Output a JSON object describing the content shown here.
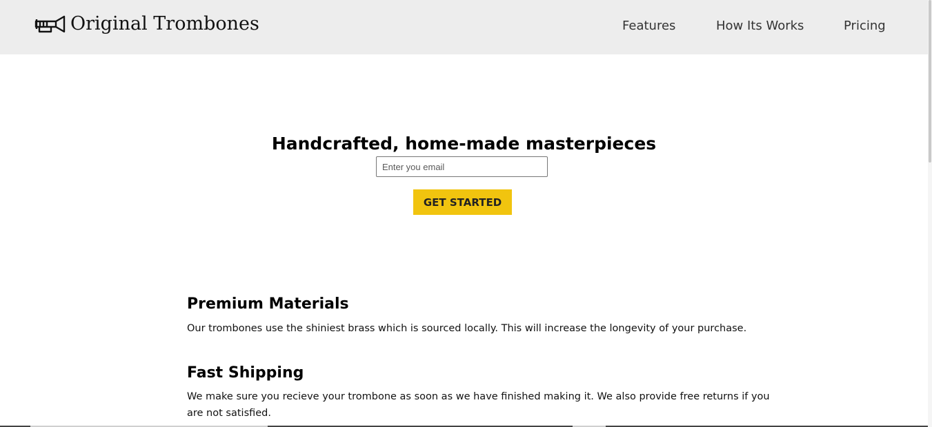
{
  "header": {
    "brand": "Original Trombones",
    "logo_icon": "trumpet-icon",
    "nav": [
      "Features",
      "How Its Works",
      "Pricing"
    ]
  },
  "hero": {
    "title": "Handcrafted, home-made masterpieces",
    "email_placeholder": "Enter you email",
    "email_value": "",
    "cta_label": "GET STARTED"
  },
  "features": [
    {
      "title": "Premium Materials",
      "text": "Our trombones use the shiniest brass which is sourced locally. This will increase the longevity of your purchase."
    },
    {
      "title": "Fast Shipping",
      "text": "We make sure you recieve your trombone as soon as we have finished making it. We also provide free returns if you are not satisfied."
    }
  ],
  "colors": {
    "header_bg": "#ededed",
    "cta_bg": "#f1c40f",
    "text": "#111111"
  }
}
